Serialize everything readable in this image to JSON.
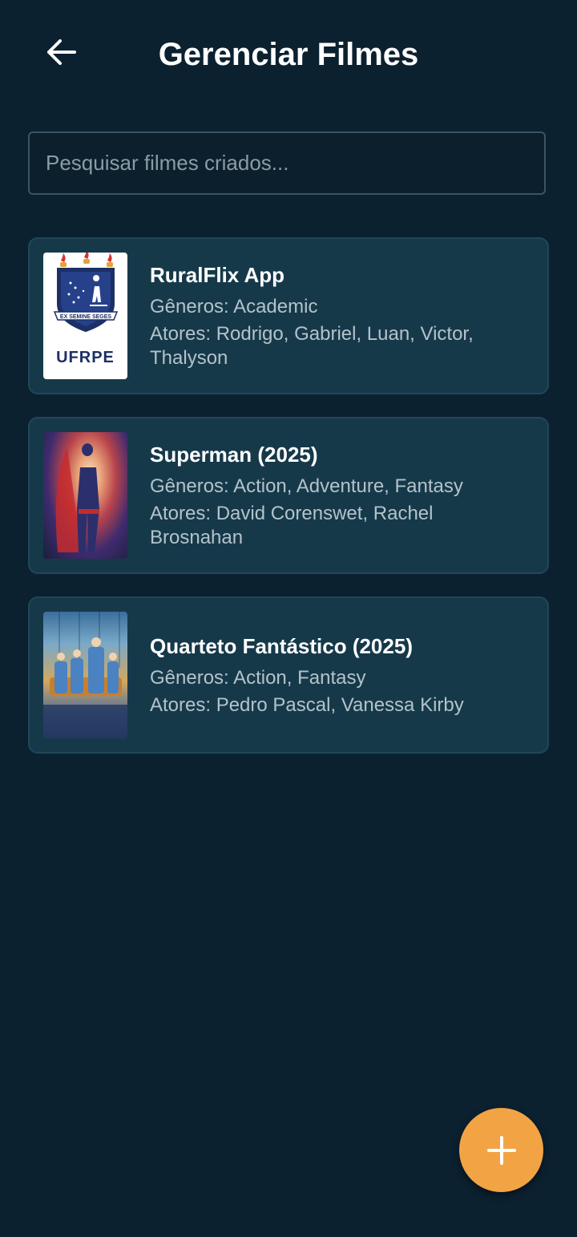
{
  "header": {
    "title": "Gerenciar Filmes",
    "back_icon": "arrow-left-icon"
  },
  "search": {
    "placeholder": "Pesquisar filmes criados...",
    "value": ""
  },
  "movies": [
    {
      "title": "RuralFlix App",
      "genres": "Gêneros: Academic",
      "actors": "Atores: Rodrigo, Gabriel, Luan, Victor, Thalyson",
      "poster_text": "UFRPE",
      "poster_motto": "EX SEMINE SEGES"
    },
    {
      "title": "Superman (2025)",
      "genres": "Gêneros: Action, Adventure, Fantasy",
      "actors": "Atores: David Corenswet, Rachel Brosnahan"
    },
    {
      "title": "Quarteto Fantástico (2025)",
      "genres": "Gêneros: Action, Fantasy",
      "actors": "Atores: Pedro Pascal, Vanessa Kirby"
    }
  ],
  "fab": {
    "icon": "plus-icon"
  },
  "colors": {
    "background": "#0b2130",
    "card": "#16394a",
    "accent": "#f2a444"
  }
}
